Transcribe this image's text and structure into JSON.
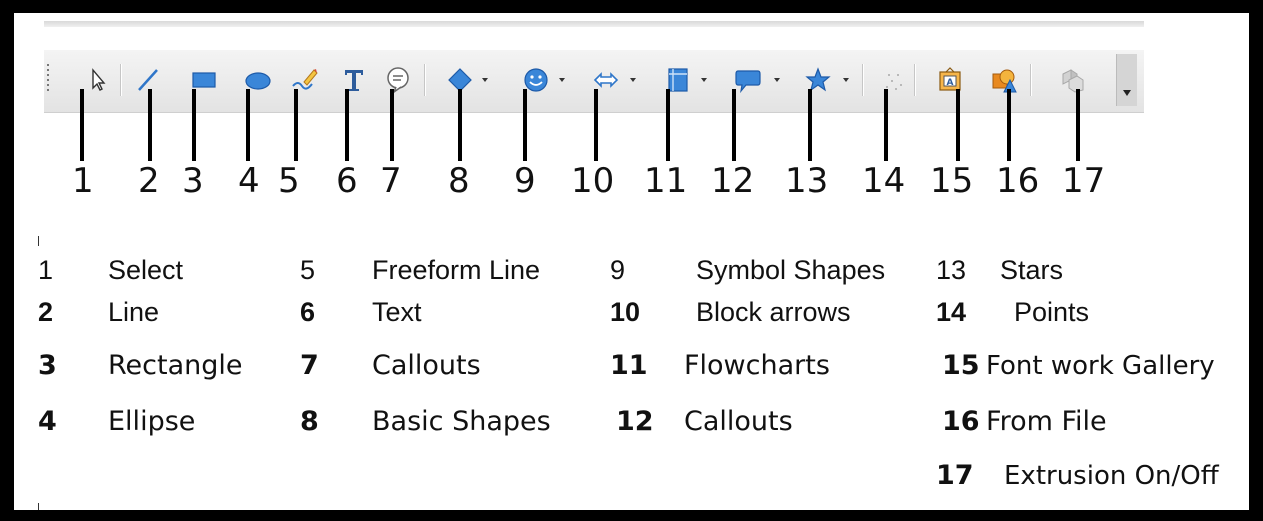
{
  "toolbar": {
    "tools": [
      {
        "number": "1",
        "icon": "select-arrow-icon"
      },
      {
        "number": "2",
        "icon": "line-icon"
      },
      {
        "number": "3",
        "icon": "rectangle-icon"
      },
      {
        "number": "4",
        "icon": "ellipse-icon"
      },
      {
        "number": "5",
        "icon": "freeform-line-icon"
      },
      {
        "number": "6",
        "icon": "text-icon"
      },
      {
        "number": "7",
        "icon": "callout-bubble-icon"
      },
      {
        "number": "8",
        "icon": "diamond-icon"
      },
      {
        "number": "9",
        "icon": "smiley-icon"
      },
      {
        "number": "10",
        "icon": "double-arrow-icon"
      },
      {
        "number": "11",
        "icon": "flowchart-icon"
      },
      {
        "number": "12",
        "icon": "speech-bubble-icon"
      },
      {
        "number": "13",
        "icon": "star-icon"
      },
      {
        "number": "14",
        "icon": "points-icon"
      },
      {
        "number": "15",
        "icon": "fontwork-gallery-icon"
      },
      {
        "number": "16",
        "icon": "from-file-icon"
      },
      {
        "number": "17",
        "icon": "extrusion-icon"
      }
    ]
  },
  "legend": [
    {
      "number": "1",
      "label": "Select"
    },
    {
      "number": "2",
      "label": "Line"
    },
    {
      "number": "3",
      "label": "Rectangle"
    },
    {
      "number": "4",
      "label": "Ellipse"
    },
    {
      "number": "5",
      "label": "Freeform Line"
    },
    {
      "number": "6",
      "label": "Text"
    },
    {
      "number": "7",
      "label": "Callouts"
    },
    {
      "number": "8",
      "label": "Basic Shapes"
    },
    {
      "number": "9",
      "label": "Symbol Shapes"
    },
    {
      "number": "10",
      "label": "Block arrows"
    },
    {
      "number": "11",
      "label": "Flowcharts"
    },
    {
      "number": "12",
      "label": "Callouts"
    },
    {
      "number": "13",
      "label": "Stars"
    },
    {
      "number": "14",
      "label": "Points"
    },
    {
      "number": "15",
      "label": "Font work Gallery"
    },
    {
      "number": "16",
      "label": "From File"
    },
    {
      "number": "17",
      "label": "Extrusion On/Off"
    }
  ],
  "colors": {
    "icon_blue": "#2f76c9",
    "icon_orange": "#e8891f",
    "frame": "#000000"
  }
}
